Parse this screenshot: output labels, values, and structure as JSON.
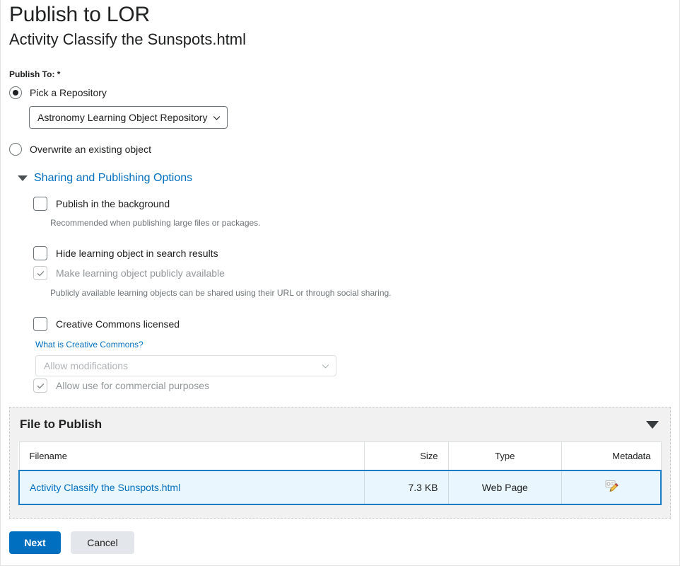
{
  "header": {
    "title": "Publish to LOR",
    "subtitle": "Activity Classify the Sunspots.html"
  },
  "publish_to": {
    "label": "Publish To:",
    "required_marker": "*",
    "options": [
      {
        "label": "Pick a Repository",
        "selected": true
      },
      {
        "label": "Overwrite an existing object",
        "selected": false
      }
    ],
    "repository_select": {
      "value": "Astronomy Learning Object Repository",
      "icon": "chevron-down-icon"
    }
  },
  "sharing": {
    "section_label": "Sharing and Publishing Options",
    "expanded": true,
    "options": [
      {
        "label": "Publish in the background",
        "checked": false,
        "disabled": false,
        "help": "Recommended when publishing large files or packages."
      },
      {
        "label": "Hide learning object in search results",
        "checked": false,
        "disabled": false,
        "help": ""
      },
      {
        "label": "Make learning object publicly available",
        "checked": true,
        "disabled": true,
        "help": "Publicly available learning objects can be shared using their URL or through social sharing."
      },
      {
        "label": "Creative Commons licensed",
        "checked": false,
        "disabled": false,
        "help": ""
      }
    ],
    "cc_link": "What is Creative Commons?",
    "cc_select": {
      "value": "Allow modifications",
      "disabled": true,
      "icon": "chevron-down-icon"
    },
    "cc_commercial": {
      "label": "Allow use for commercial purposes",
      "checked": true,
      "disabled": true
    }
  },
  "file_panel": {
    "title": "File to Publish",
    "collapse_icon": "triangle-down-icon",
    "columns": [
      "Filename",
      "Size",
      "Type",
      "Metadata"
    ],
    "rows": [
      {
        "filename": "Activity Classify the Sunspots.html",
        "size": "7.3 KB",
        "type": "Web Page",
        "metadata_icon": "edit-metadata-icon",
        "selected": true
      }
    ]
  },
  "footer": {
    "primary_button": "Next",
    "secondary_button": "Cancel"
  },
  "colors": {
    "accent": "#006fbf",
    "selected_row_bg": "#e9f6fd",
    "selected_row_border": "#1c7cc4",
    "panel_bg": "#f1f1f1",
    "secondary_button_bg": "#e3e7eb",
    "muted_text": "#6e7477"
  }
}
